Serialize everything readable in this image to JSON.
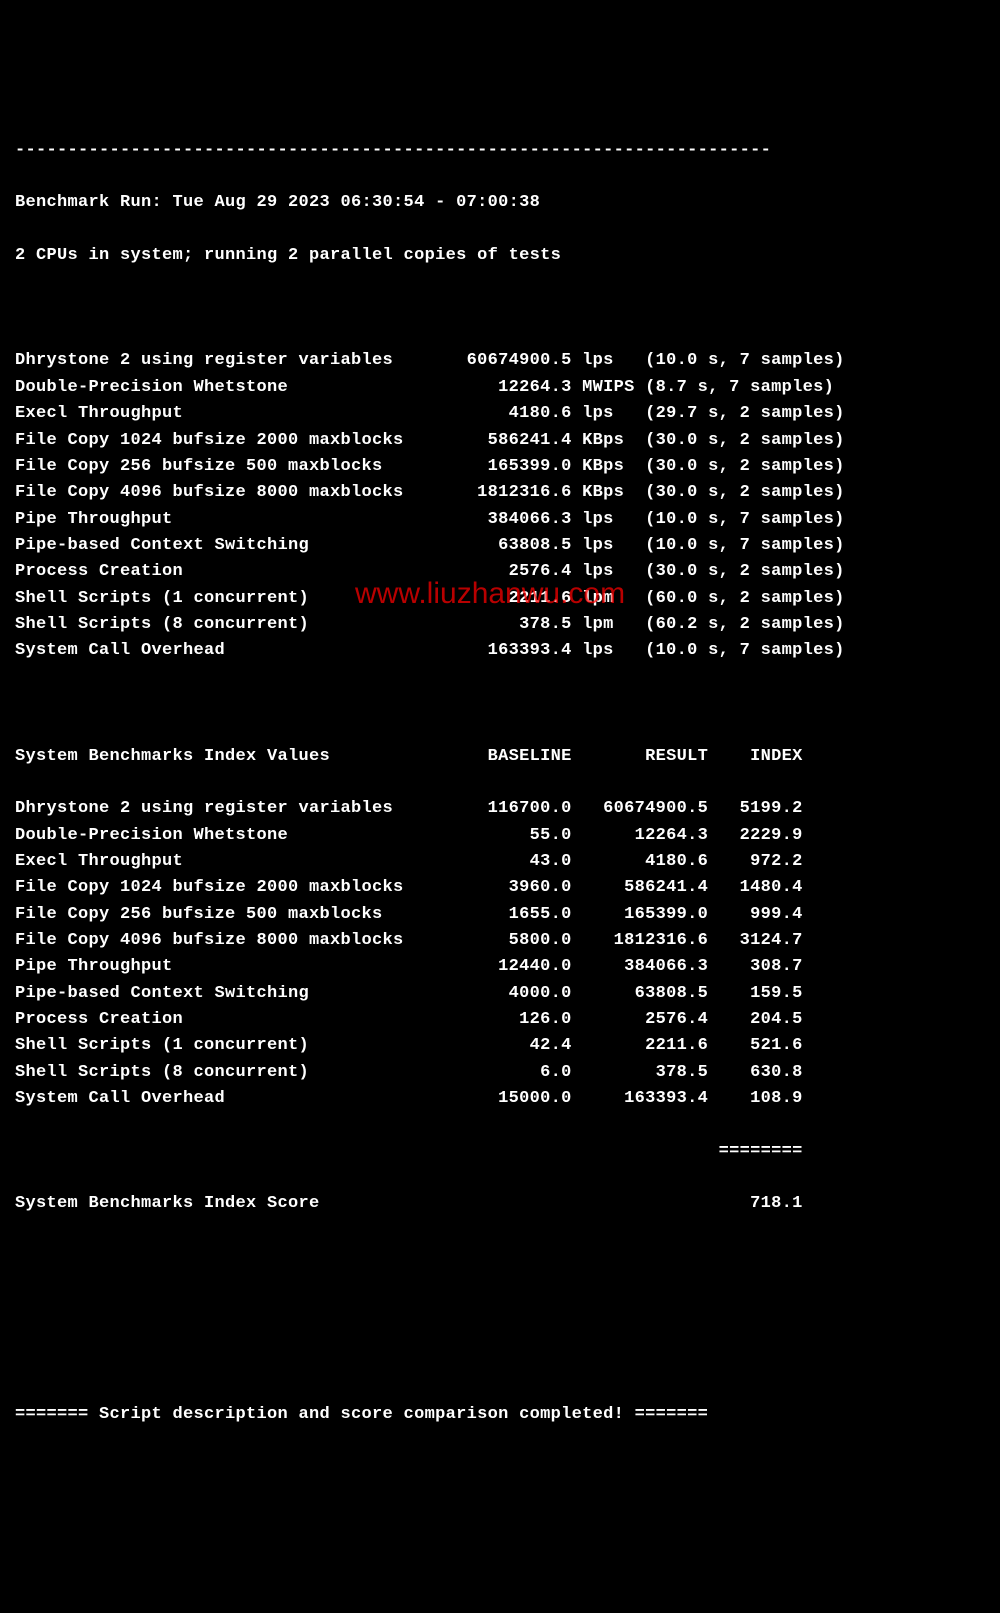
{
  "terminal": {
    "divider_line": "------------------------------------------------------------------------",
    "run_line": "Benchmark Run: Tue Aug 29 2023 06:30:54 - 07:00:38",
    "cpu_line": "2 CPUs in system; running 2 parallel copies of tests",
    "results_header": {
      "name_col": "System Benchmarks Index Values",
      "baseline": "BASELINE",
      "result": "RESULT",
      "index": "INDEX"
    },
    "tests": [
      {
        "name": "Dhrystone 2 using register variables",
        "value": "60674900.5",
        "unit": "lps",
        "timing": "(10.0 s, 7 samples)"
      },
      {
        "name": "Double-Precision Whetstone",
        "value": "12264.3",
        "unit": "MWIPS",
        "timing": "(8.7 s, 7 samples)"
      },
      {
        "name": "Execl Throughput",
        "value": "4180.6",
        "unit": "lps",
        "timing": "(29.7 s, 2 samples)"
      },
      {
        "name": "File Copy 1024 bufsize 2000 maxblocks",
        "value": "586241.4",
        "unit": "KBps",
        "timing": "(30.0 s, 2 samples)"
      },
      {
        "name": "File Copy 256 bufsize 500 maxblocks",
        "value": "165399.0",
        "unit": "KBps",
        "timing": "(30.0 s, 2 samples)"
      },
      {
        "name": "File Copy 4096 bufsize 8000 maxblocks",
        "value": "1812316.6",
        "unit": "KBps",
        "timing": "(30.0 s, 2 samples)"
      },
      {
        "name": "Pipe Throughput",
        "value": "384066.3",
        "unit": "lps",
        "timing": "(10.0 s, 7 samples)"
      },
      {
        "name": "Pipe-based Context Switching",
        "value": "63808.5",
        "unit": "lps",
        "timing": "(10.0 s, 7 samples)"
      },
      {
        "name": "Process Creation",
        "value": "2576.4",
        "unit": "lps",
        "timing": "(30.0 s, 2 samples)"
      },
      {
        "name": "Shell Scripts (1 concurrent)",
        "value": "2211.6",
        "unit": "lpm",
        "timing": "(60.0 s, 2 samples)"
      },
      {
        "name": "Shell Scripts (8 concurrent)",
        "value": "378.5",
        "unit": "lpm",
        "timing": "(60.2 s, 2 samples)"
      },
      {
        "name": "System Call Overhead",
        "value": "163393.4",
        "unit": "lps",
        "timing": "(10.0 s, 7 samples)"
      }
    ],
    "index_rows": [
      {
        "name": "Dhrystone 2 using register variables",
        "baseline": "116700.0",
        "result": "60674900.5",
        "index": "5199.2"
      },
      {
        "name": "Double-Precision Whetstone",
        "baseline": "55.0",
        "result": "12264.3",
        "index": "2229.9"
      },
      {
        "name": "Execl Throughput",
        "baseline": "43.0",
        "result": "4180.6",
        "index": "972.2"
      },
      {
        "name": "File Copy 1024 bufsize 2000 maxblocks",
        "baseline": "3960.0",
        "result": "586241.4",
        "index": "1480.4"
      },
      {
        "name": "File Copy 256 bufsize 500 maxblocks",
        "baseline": "1655.0",
        "result": "165399.0",
        "index": "999.4"
      },
      {
        "name": "File Copy 4096 bufsize 8000 maxblocks",
        "baseline": "5800.0",
        "result": "1812316.6",
        "index": "3124.7"
      },
      {
        "name": "Pipe Throughput",
        "baseline": "12440.0",
        "result": "384066.3",
        "index": "308.7"
      },
      {
        "name": "Pipe-based Context Switching",
        "baseline": "4000.0",
        "result": "63808.5",
        "index": "159.5"
      },
      {
        "name": "Process Creation",
        "baseline": "126.0",
        "result": "2576.4",
        "index": "204.5"
      },
      {
        "name": "Shell Scripts (1 concurrent)",
        "baseline": "42.4",
        "result": "2211.6",
        "index": "521.6"
      },
      {
        "name": "Shell Scripts (8 concurrent)",
        "baseline": "6.0",
        "result": "378.5",
        "index": "630.8"
      },
      {
        "name": "System Call Overhead",
        "baseline": "15000.0",
        "result": "163393.4",
        "index": "108.9"
      }
    ],
    "sep_line": "                                                                   ========",
    "score_label": "System Benchmarks Index Score",
    "score_value": "718.1",
    "footer": "======= Script description and score comparison completed! ======="
  },
  "watermark": "www.liuzhanwu.com"
}
